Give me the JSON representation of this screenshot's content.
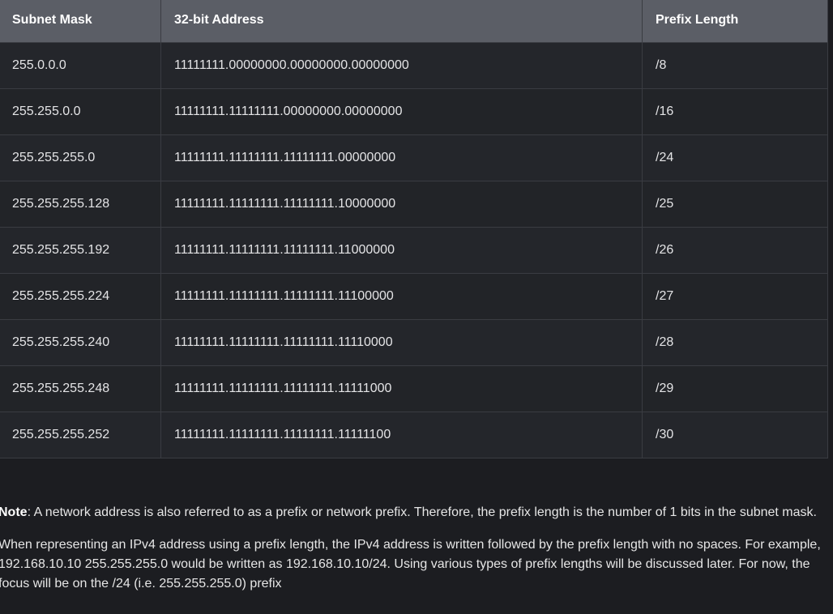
{
  "table": {
    "headers": [
      "Subnet Mask",
      "32-bit Address",
      "Prefix Length"
    ],
    "rows": [
      [
        "255.0.0.0",
        "11111111.00000000.00000000.00000000",
        "/8"
      ],
      [
        "255.255.0.0",
        "11111111.11111111.00000000.00000000",
        "/16"
      ],
      [
        "255.255.255.0",
        "11111111.11111111.11111111.00000000",
        "/24"
      ],
      [
        "255.255.255.128",
        "11111111.11111111.11111111.10000000",
        "/25"
      ],
      [
        "255.255.255.192",
        "11111111.11111111.11111111.11000000",
        "/26"
      ],
      [
        "255.255.255.224",
        "11111111.11111111.11111111.11100000",
        "/27"
      ],
      [
        "255.255.255.240",
        "11111111.11111111.11111111.11110000",
        "/28"
      ],
      [
        "255.255.255.248",
        "11111111.11111111.11111111.11111000",
        "/29"
      ],
      [
        "255.255.255.252",
        "11111111.11111111.11111111.11111100",
        "/30"
      ]
    ]
  },
  "note": {
    "label": "Note",
    "text": ": A network address is also referred to as a prefix or network prefix. Therefore, the prefix length is the number of 1 bits in the subnet mask."
  },
  "paragraph": "When representing an IPv4 address using a prefix length, the IPv4 address is written followed by the prefix length with no spaces. For example, 192.168.10.10 255.255.255.0 would be written as 192.168.10.10/24. Using various types of prefix lengths will be discussed later. For now, the focus will be on the /24 (i.e. 255.255.255.0) prefix"
}
